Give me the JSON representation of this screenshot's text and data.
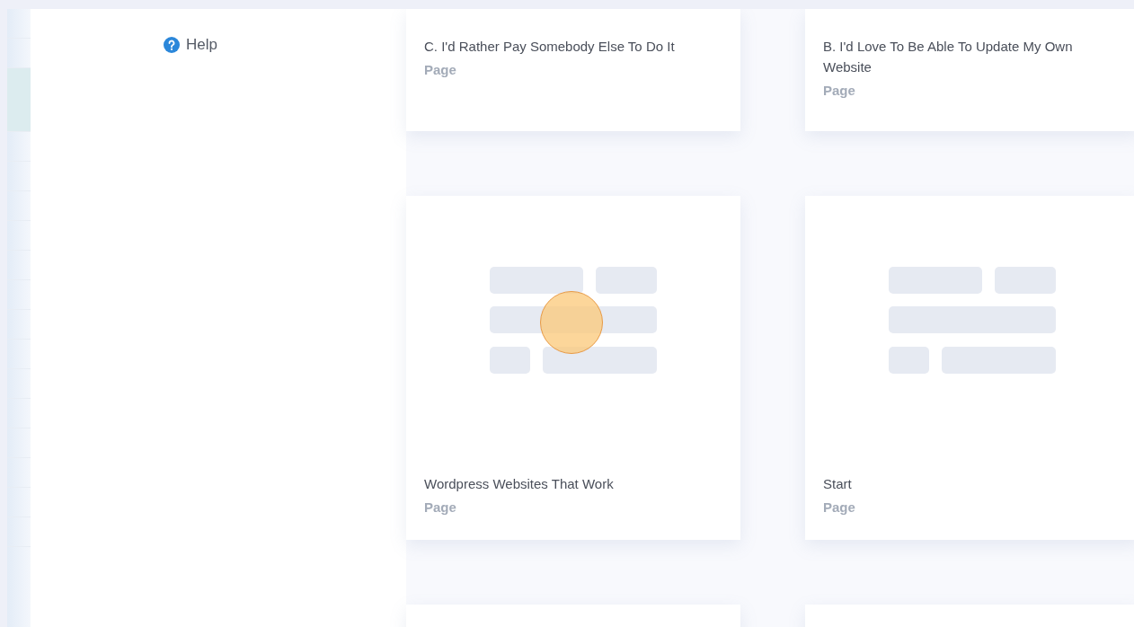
{
  "help": {
    "label": "Help"
  },
  "cards": [
    {
      "kind": "text",
      "title": "C. I'd Rather Pay Somebody Else To Do It",
      "type": "Page"
    },
    {
      "kind": "text",
      "title": "B. I'd Love To Be Able To Update My Own Website",
      "type": "Page"
    },
    {
      "kind": "preview",
      "title": "Wordpress Websites That Work",
      "type": "Page"
    },
    {
      "kind": "preview",
      "title": "Start",
      "type": "Page"
    },
    {
      "kind": "blank"
    },
    {
      "kind": "blank"
    }
  ]
}
